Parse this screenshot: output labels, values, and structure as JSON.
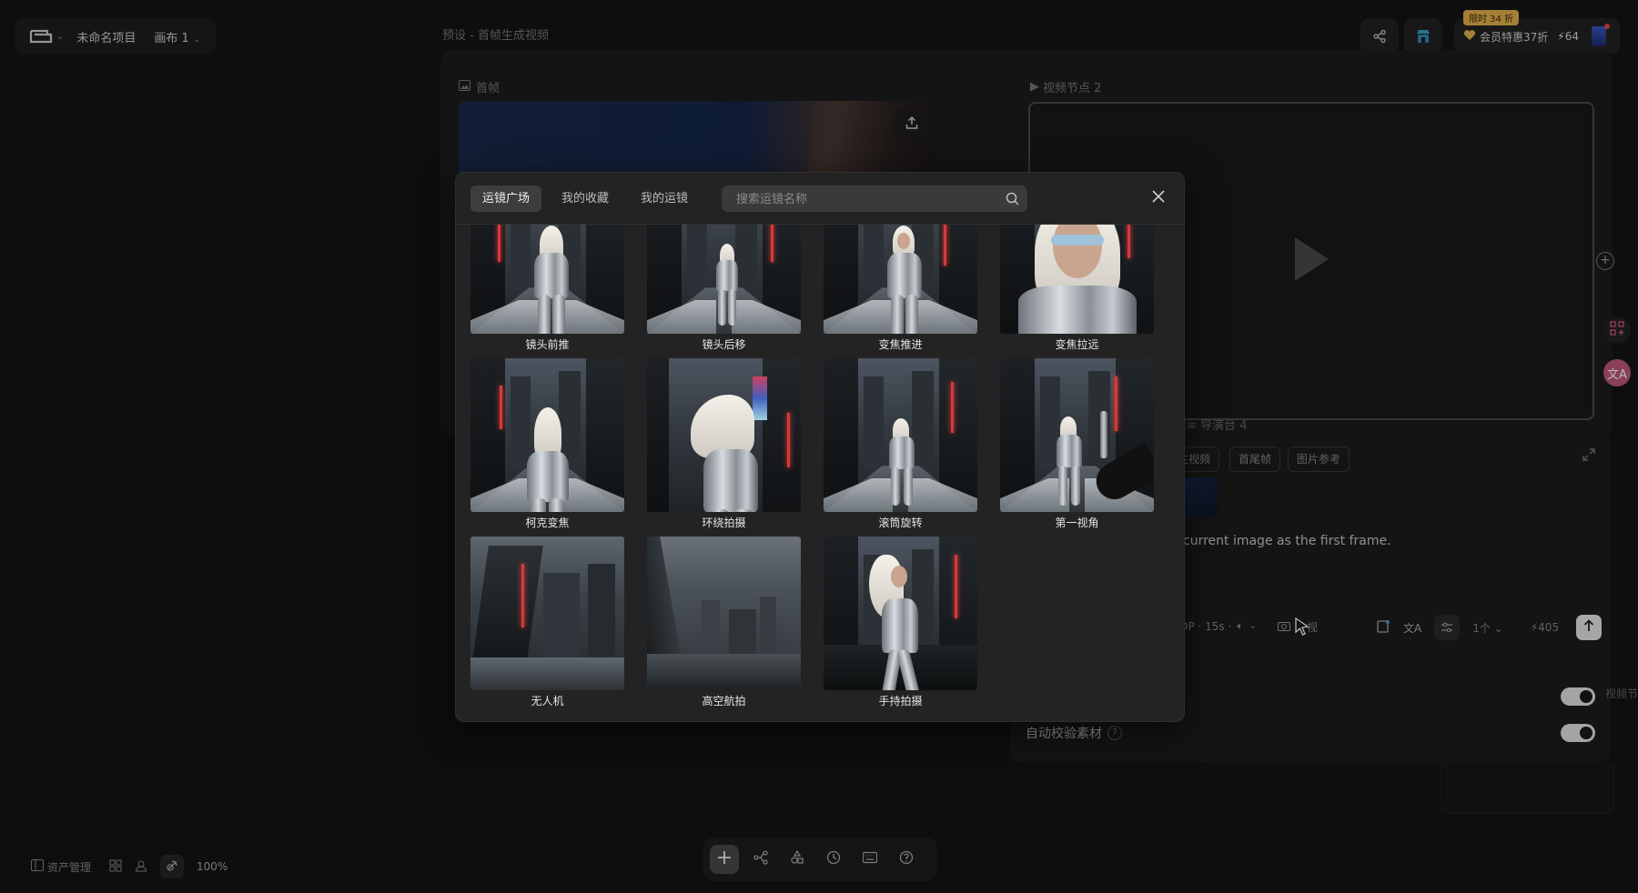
{
  "app": {
    "project_name": "未命名项目",
    "canvas_label": "画布 1",
    "preset_title": "预设 - 首帧生成视频"
  },
  "topbar": {
    "vip_tag": "限时 34 折",
    "vip_label": "会员特惠37折",
    "credits": "64",
    "icons": [
      "share-icon",
      "store-icon",
      "avatar-icon"
    ]
  },
  "node": {
    "first_frame_label": "首帧",
    "video_node_label": "视频节点 2"
  },
  "editor": {
    "director_label": "导演台 4",
    "chips": [
      "生视频",
      "首尾帧",
      "图片参考"
    ],
    "prompt": "current image as the first frame.",
    "gen_settings": "OP · 15s ·",
    "mode_label": "视",
    "count": "1个",
    "cost": "405",
    "auto_verify_label": "自动校验素材",
    "right_extra": "视频节"
  },
  "modal": {
    "tabs": [
      {
        "label": "运镜广场",
        "active": true
      },
      {
        "label": "我的收藏",
        "active": false
      },
      {
        "label": "我的运镜",
        "active": false
      }
    ],
    "search_placeholder": "搜索运镜名称",
    "items": [
      {
        "label": "镜头前推"
      },
      {
        "label": "镜头后移"
      },
      {
        "label": "变焦推进"
      },
      {
        "label": "变焦拉远"
      },
      {
        "label": "柯克变焦"
      },
      {
        "label": "环绕拍摄"
      },
      {
        "label": "滚筒旋转"
      },
      {
        "label": "第一视角"
      },
      {
        "label": "无人机"
      },
      {
        "label": "高空航拍"
      },
      {
        "label": "手持拍摄"
      }
    ]
  },
  "bottom": {
    "assets_label": "资产管理",
    "zoom": "100%"
  },
  "colors": {
    "background": "#141414",
    "modal_bg": "#232323",
    "tab_active_bg": "#3d3d3d",
    "vip_tag": "#e3b04b",
    "neon_red": "#d53a3a"
  }
}
